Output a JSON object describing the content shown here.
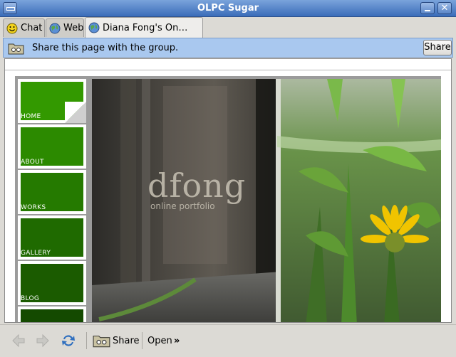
{
  "window": {
    "title": "OLPC Sugar"
  },
  "tabs": [
    {
      "label": "Chat",
      "icon": "smiley-icon"
    },
    {
      "label": "Web",
      "icon": "globe-icon"
    },
    {
      "label": "Diana Fong's On…",
      "icon": "globe-icon"
    }
  ],
  "share_bar": {
    "message": "Share this page with the group.",
    "button_label": "Share"
  },
  "site": {
    "logo_text": "dfong",
    "logo_subtitle": "online portfolio",
    "nav": [
      "HOME",
      "ABOUT",
      "WORKS",
      "GALLERY",
      "BLOG"
    ]
  },
  "toolbar": {
    "share_label": "Share",
    "open_label": "Open",
    "more_label": "»"
  },
  "colors": {
    "titlebar": "#3a6cb9",
    "share_bar": "#a9c8ef",
    "nav_home": "#339900",
    "nav_dark": "#1f5a00"
  }
}
